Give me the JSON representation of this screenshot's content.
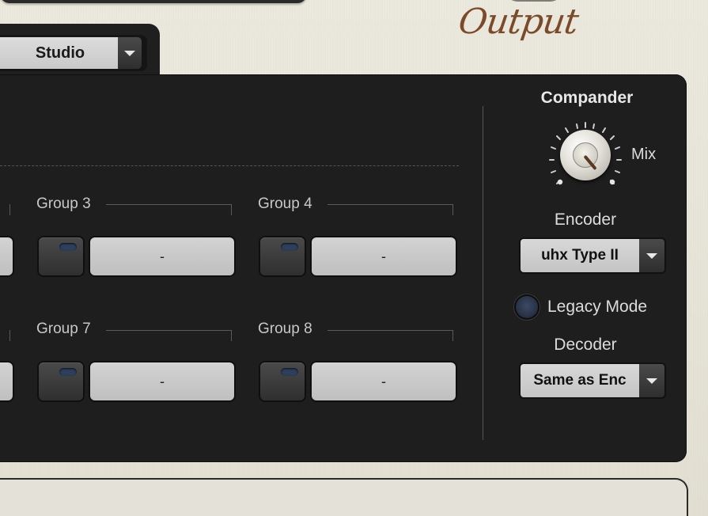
{
  "header": {
    "section_title": "Output"
  },
  "preset": {
    "value": "Studio"
  },
  "groups": [
    {
      "label": "Group 3",
      "value": "-"
    },
    {
      "label": "Group 4",
      "value": "-"
    },
    {
      "label": "Group 7",
      "value": "-"
    },
    {
      "label": "Group 8",
      "value": "-"
    }
  ],
  "compander": {
    "title": "Compander",
    "mix_label": "Mix",
    "encoder_label": "Encoder",
    "encoder_value": "uhx Type II",
    "legacy_label": "Legacy Mode",
    "decoder_label": "Decoder",
    "decoder_value": "Same as Enc"
  }
}
